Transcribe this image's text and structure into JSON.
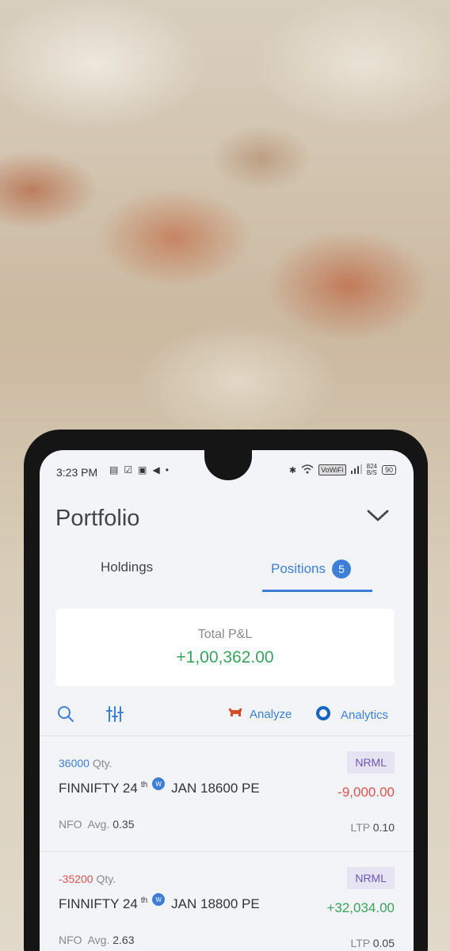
{
  "status_bar": {
    "time": "3:23 PM",
    "vowifi": "VoWiFi",
    "net_speed_value": "824",
    "net_speed_unit": "B/S",
    "battery": "90"
  },
  "header": {
    "title": "Portfolio"
  },
  "tabs": {
    "holdings": "Holdings",
    "positions": "Positions",
    "positions_count": "5"
  },
  "summary": {
    "label": "Total P&L",
    "value": "+1,00,362.00"
  },
  "toolbar": {
    "analyze_label": "Analyze",
    "analytics_label": "Analytics"
  },
  "positions": [
    {
      "qty": "36000",
      "qty_unit": "Qty.",
      "product": "NRML",
      "symbol": "FINNIFTY 24",
      "ordinal": "th",
      "weekly_badge": "W",
      "contract": "JAN 18600 PE",
      "pnl": "-9,000.00",
      "exchange": "NFO",
      "avg_label": "Avg.",
      "avg": "0.35",
      "ltp_label": "LTP",
      "ltp": "0.10"
    },
    {
      "qty": "-35200",
      "qty_unit": "Qty.",
      "product": "NRML",
      "symbol": "FINNIFTY 24",
      "ordinal": "th",
      "weekly_badge": "W",
      "contract": "JAN 18800 PE",
      "pnl": "+32,034.00",
      "exchange": "NFO",
      "avg_label": "Avg.",
      "avg": "2.63",
      "ltp_label": "LTP",
      "ltp": "0.05"
    }
  ],
  "colors": {
    "accent": "#3d7fd6",
    "profit": "#3aa15e",
    "loss": "#d9534f",
    "product_badge": "#6a56b3"
  }
}
